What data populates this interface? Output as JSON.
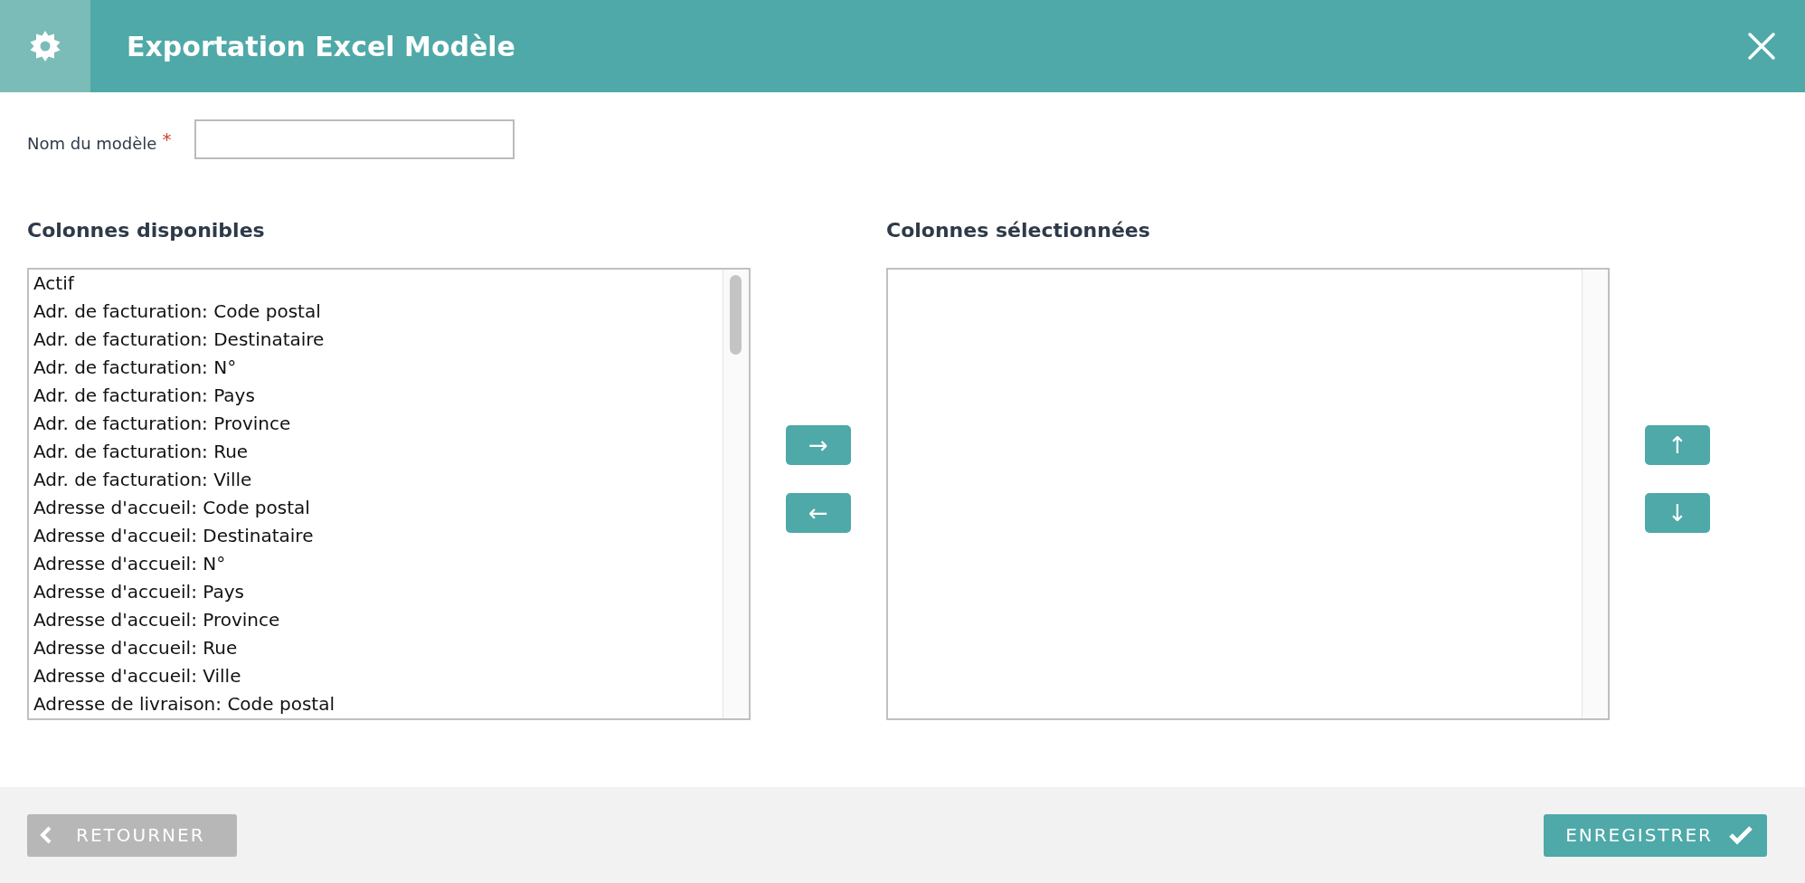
{
  "header": {
    "title": "Exportation Excel Modèle"
  },
  "form": {
    "label": "Nom du modèle",
    "required_mark": "*"
  },
  "available": {
    "title": "Colonnes disponibles",
    "items": [
      "Actif",
      "Adr. de facturation: Code postal",
      "Adr. de facturation: Destinataire",
      "Adr. de facturation: N°",
      "Adr. de facturation: Pays",
      "Adr. de facturation: Province",
      "Adr. de facturation: Rue",
      "Adr. de facturation: Ville",
      "Adresse d'accueil: Code postal",
      "Adresse d'accueil: Destinataire",
      "Adresse d'accueil: N°",
      "Adresse d'accueil: Pays",
      "Adresse d'accueil: Province",
      "Adresse d'accueil: Rue",
      "Adresse d'accueil: Ville",
      "Adresse de livraison: Code postal"
    ]
  },
  "transfer_buttons": [
    "→",
    "←"
  ],
  "selected": {
    "title": "Colonnes sélectionnées"
  },
  "order_buttons": [
    "↑",
    "↓"
  ],
  "footer": {
    "back": "RETOURNER",
    "save": "ENREGISTRER"
  }
}
